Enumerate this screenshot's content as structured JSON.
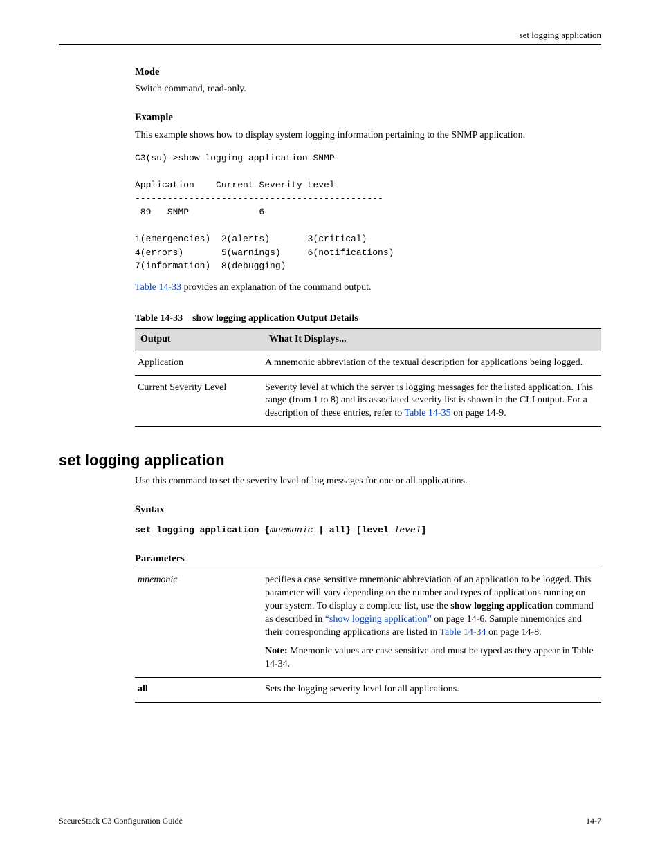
{
  "header": {
    "right": "set logging application"
  },
  "sect_mode": {
    "heading": "Mode",
    "text": "Switch command, read-only."
  },
  "sect_example": {
    "heading": "Example",
    "text": "This example shows how to display system logging information pertaining to the SNMP application.",
    "code": "C3(su)->show logging application SNMP\n\nApplication    Current Severity Level\n----------------------------------------------\n 89   SNMP             6\n\n1(emergencies)  2(alerts)       3(critical)\n4(errors)       5(warnings)     6(notifications)\n7(information)  8(debugging)",
    "post_pre": "Table 14-33",
    "post_post": " provides an explanation of the command output."
  },
  "tbl33": {
    "caption": "Table 14-33 show logging application Output Details",
    "head_c1": "Output",
    "head_c2": "What It Displays...",
    "r1c1": "Application",
    "r1c2": "A mnemonic abbreviation of the textual description for applications being logged.",
    "r2c1": "Current Severity Level",
    "r2c2_pre": "Severity level at which the server is logging messages for the listed application. This range (from 1 to 8) and its associated severity list is shown in the CLI output. For a description of these entries, refer to ",
    "r2c2_link": "Table 14-35",
    "r2c2_post": " on page 14-9."
  },
  "cmd": {
    "title": "set logging application",
    "desc": "Use this command to set the severity level of log messages for one or all applications.",
    "syntax_heading": "Syntax",
    "syntax_pre": "set logging application {",
    "syntax_mnem": "mnemonic",
    "syntax_mid": " | all} [level ",
    "syntax_level": "level",
    "syntax_end": "]",
    "params_heading": "Parameters"
  },
  "params": {
    "r1c1": "mnemonic",
    "r1_p1": "pecifies a case sensitive mnemonic abbreviation of an application to be logged. This parameter will vary depending on the number and types of applications running on your system. To display a complete list, use the ",
    "r1_bold": "show logging application",
    "r1_p2": " command as described in ",
    "r1_link1a": "“show logging ",
    "r1_link1b": "application”",
    "r1_p3": " on page 14-6. Sample mnemonics and their corresponding applications are listed in ",
    "r1_link2": "Table 14-34",
    "r1_p4": " on page 14-8.",
    "r1_note_head": "Note:",
    "r1_note_body": " Mnemonic values are case sensitive and must be typed as they appear in Table 14-34.",
    "r2c1": "all",
    "r2c2": "Sets the logging severity level for all applications."
  },
  "footer": {
    "left": "SecureStack C3 Configuration Guide",
    "right": "14-7"
  }
}
